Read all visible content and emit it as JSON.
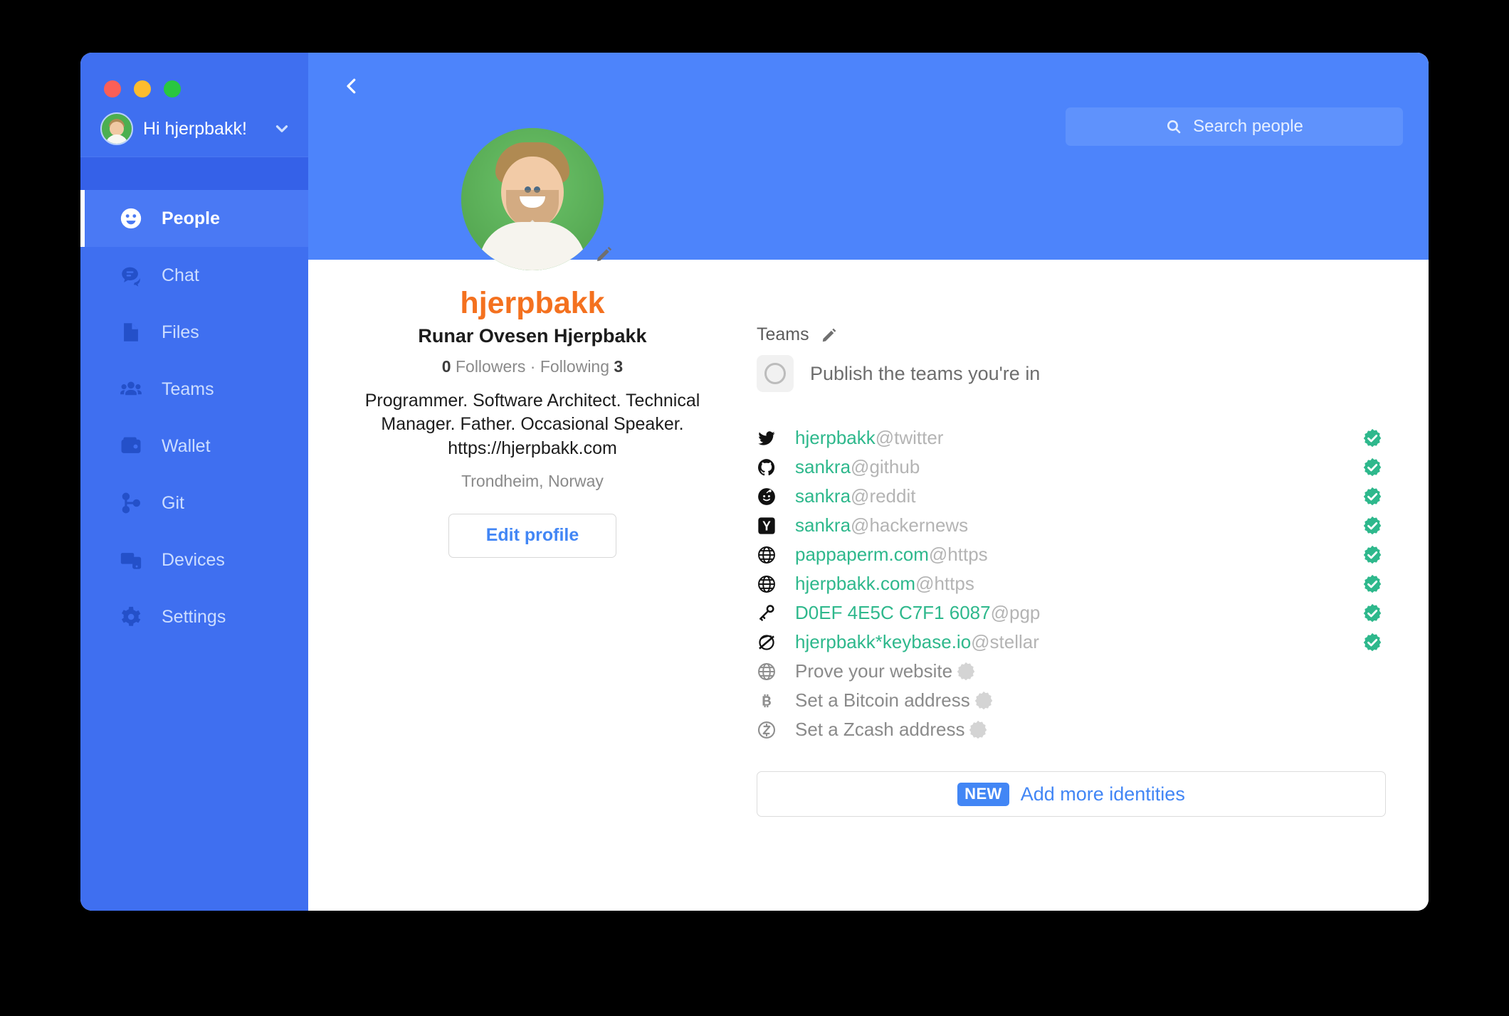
{
  "window": {
    "traffic_lights": [
      "close",
      "minimize",
      "zoom"
    ]
  },
  "sidebar": {
    "greeting": "Hi hjerpbakk!",
    "avatar_name": "user-avatar",
    "chevron": "chevron-down-icon",
    "items": [
      {
        "label": "People",
        "icon": "people-icon",
        "active": true
      },
      {
        "label": "Chat",
        "icon": "chat-icon",
        "active": false
      },
      {
        "label": "Files",
        "icon": "files-icon",
        "active": false
      },
      {
        "label": "Teams",
        "icon": "teams-icon",
        "active": false
      },
      {
        "label": "Wallet",
        "icon": "wallet-icon",
        "active": false
      },
      {
        "label": "Git",
        "icon": "git-icon",
        "active": false
      },
      {
        "label": "Devices",
        "icon": "devices-icon",
        "active": false
      },
      {
        "label": "Settings",
        "icon": "gear-icon",
        "active": false
      }
    ]
  },
  "header": {
    "back_icon": "chevron-left-icon",
    "search_placeholder": "Search people",
    "search_icon": "search-icon"
  },
  "profile": {
    "username": "hjerpbakk",
    "fullname": "Runar Ovesen Hjerpbakk",
    "followers_count": "0",
    "followers_label": "Followers",
    "following_label": "Following",
    "following_count": "3",
    "bio": "Programmer. Software Architect. Technical Manager. Father. Occasional Speaker. https://hjerpbakk.com",
    "location": "Trondheim, Norway",
    "edit_button": "Edit profile",
    "avatar_edit_icon": "pencil-icon"
  },
  "teams": {
    "label": "Teams",
    "edit_icon": "pencil-icon",
    "publish_label": "Publish the teams you're in",
    "publish_checked": false
  },
  "identities": {
    "rows": [
      {
        "icon": "twitter-icon",
        "name": "hjerpbakk",
        "service": "@twitter",
        "verified": true
      },
      {
        "icon": "github-icon",
        "name": "sankra",
        "service": "@github",
        "verified": true
      },
      {
        "icon": "reddit-icon",
        "name": "sankra",
        "service": "@reddit",
        "verified": true
      },
      {
        "icon": "hackernews-icon",
        "name": "sankra",
        "service": "@hackernews",
        "verified": true
      },
      {
        "icon": "globe-icon",
        "name": "pappaperm.com",
        "service": "@https",
        "verified": true
      },
      {
        "icon": "globe-icon",
        "name": "hjerpbakk.com",
        "service": "@https",
        "verified": true
      },
      {
        "icon": "key-icon",
        "name": "D0EF 4E5C C7F1 6087",
        "service": "@pgp",
        "verified": true
      },
      {
        "icon": "stellar-icon",
        "name": "hjerpbakk*keybase.io",
        "service": "@stellar",
        "verified": true
      }
    ],
    "todo_rows": [
      {
        "icon": "globe-icon",
        "label": "Prove your website"
      },
      {
        "icon": "bitcoin-icon",
        "label": "Set a Bitcoin address"
      },
      {
        "icon": "zcash-icon",
        "label": "Set a Zcash address"
      }
    ],
    "add_more": {
      "badge": "NEW",
      "label": "Add more identities"
    }
  },
  "colors": {
    "header_blue": "#4d84fb",
    "sidebar_blue": "#3f6ff0",
    "sidebar_active": "#4a79f4",
    "accent_orange": "#f4711f",
    "link_blue": "#4286f5",
    "verified_green": "#2eb88c",
    "identity_green": "#2eb88c"
  }
}
